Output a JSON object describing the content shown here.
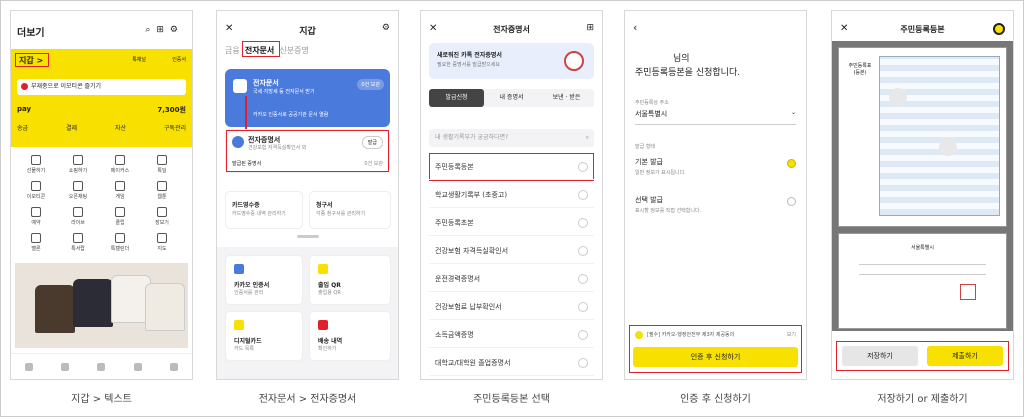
{
  "captions": [
    "지갑 > 텍스트",
    "전자문서 > 전자증명서",
    "주민등록등본 선택",
    "인증 후 신청하기",
    "저장하기 or 제출하기"
  ],
  "screen1": {
    "title": "더보기",
    "wallet_label": "지갑 >",
    "cert_label": "인증서",
    "shop_label": "톡채널",
    "banner_text": "부재중으로 이모티콘 즐기기",
    "pay_label": "pay",
    "pay_amount": "7,300원",
    "pay_tabs": [
      "송금",
      "결제",
      "자산",
      "구독관리"
    ],
    "grid": [
      "선물하기",
      "쇼핑하기",
      "메이커스",
      "톡딜",
      "이모티콘",
      "오픈채팅",
      "게임",
      "웹툰",
      "예약",
      "라이브",
      "클립",
      "장보기",
      "멜론",
      "톡서랍",
      "톡캘린더",
      "지도"
    ]
  },
  "screen2": {
    "title": "지갑",
    "tabs": [
      "금융",
      "전자문서",
      "신분증명"
    ],
    "blue_title": "전자문서",
    "blue_sub": "국세·지방세 등 전자문서 받기",
    "blue_badge": "0건 보관",
    "blue_note": "카카오 인증서로 공공기관 문서 열람",
    "cert_title": "전자증명서",
    "cert_sub": "건강보험 자격득실확인서 외",
    "cert_btn": "발급",
    "issued_label": "발급된 증명서",
    "issued_count": "0건 보관",
    "card1_title": "카드영수증",
    "card1_sub": "카드영수증 내역 관리하기",
    "card2_title": "청구서",
    "card2_sub": "각종 청구서를 관리하기",
    "tile1": "카카오 인증서",
    "tile1_sub": "인증서를 관리",
    "tile2": "출입 QR",
    "tile2_sub": "출입용 QR",
    "tile3": "디지털카드",
    "tile3_sub": "카드 목록",
    "tile4": "배송 내역",
    "tile4_sub": "확인하기"
  },
  "screen3": {
    "title": "전자증명서",
    "banner": "새로워진 카톡 전자증명서",
    "banner_sub": "필요한 증명서를 발급받으세요",
    "tabs": [
      "발급신청",
      "내 증명서",
      "보낸 · 받은"
    ],
    "search_placeholder": "내 생활기록부가 궁금하다면?",
    "items": [
      "주민등록등본",
      "학교생활기록부 (초중고)",
      "주민등록초본",
      "건강보험 자격득실확인서",
      "운전경력증명서",
      "건강보험료 납부확인서",
      "소득금액증명",
      "대학교/대학원 졸업증명서"
    ]
  },
  "screen4": {
    "greeting": "님의",
    "headline": "주민등록등본을 신청합니다.",
    "addr_label": "주민등록상 주소",
    "addr_value": "서울특별시",
    "type_label": "발급 형태",
    "opt1": "기본 발급",
    "opt1_sub": "일반 정보가 표시됩니다.",
    "opt2": "선택 발급",
    "opt2_sub": "표시할 정보를 직접 선택합니다.",
    "agree": "[필수] 카카오-행정안전부 제3자 제공동의",
    "agree_more": "보기",
    "submit": "인증 후 신청하기"
  },
  "screen5": {
    "title": "주민등록등본",
    "doc_head": "주민등록표 (등본)",
    "seal": "서울특별시",
    "save": "저장하기",
    "submit": "제출하기"
  },
  "colors": {
    "yellow": "#f8e000",
    "blue": "#4a7bdc",
    "red": "#e0202a"
  }
}
